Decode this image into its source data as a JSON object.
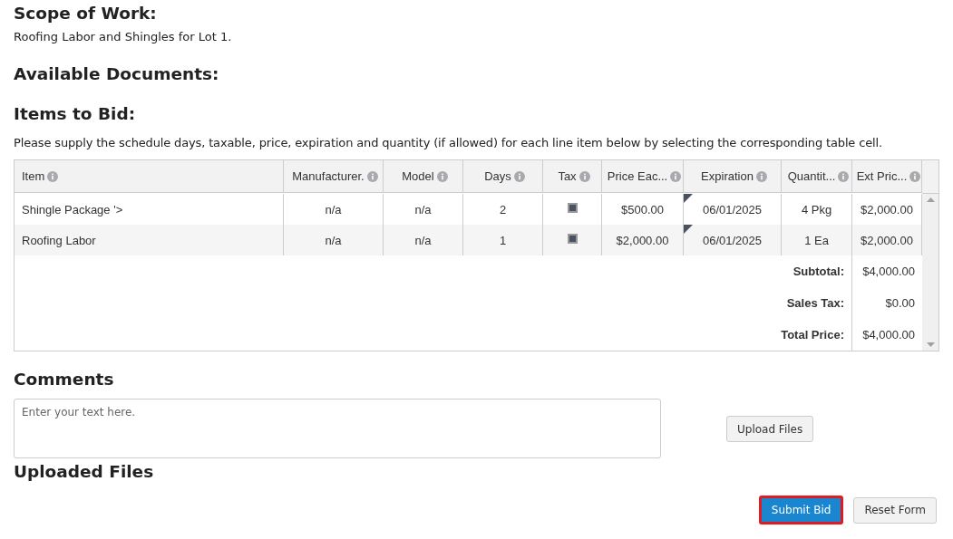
{
  "scope": {
    "heading": "Scope of Work:",
    "text": "Roofing Labor and Shingles for Lot 1."
  },
  "documents": {
    "heading": "Available Documents:"
  },
  "items": {
    "heading": "Items to Bid:",
    "instructions": "Please supply the schedule days, taxable, price, expiration and quantity (if allowed) for each line item below by selecting the corresponding table cell.",
    "columns": [
      {
        "label": "Item"
      },
      {
        "label": "Manufacturer."
      },
      {
        "label": "Model"
      },
      {
        "label": "Days"
      },
      {
        "label": "Tax"
      },
      {
        "label": "Price Eac..."
      },
      {
        "label": "Expiration"
      },
      {
        "label": "Quantit..."
      },
      {
        "label": "Ext Pric..."
      }
    ],
    "rows": [
      {
        "item": "Shingle Package '>",
        "manufacturer": "n/a",
        "model": "n/a",
        "days": "2",
        "tax_checked": true,
        "price": "$500.00",
        "expiration": "06/01/2025",
        "quantity": "4 Pkg",
        "ext_price": "$2,000.00"
      },
      {
        "item": "Roofing Labor",
        "manufacturer": "n/a",
        "model": "n/a",
        "days": "1",
        "tax_checked": true,
        "price": "$2,000.00",
        "expiration": "06/01/2025",
        "quantity": "1 Ea",
        "ext_price": "$2,000.00"
      }
    ],
    "totals": [
      {
        "label": "Subtotal:",
        "value": "$4,000.00"
      },
      {
        "label": "Sales Tax:",
        "value": "$0.00"
      },
      {
        "label": "Total Price:",
        "value": "$4,000.00"
      }
    ]
  },
  "comments": {
    "heading": "Comments",
    "placeholder": "Enter your text here.",
    "upload_button": "Upload Files"
  },
  "uploaded": {
    "heading": "Uploaded Files"
  },
  "buttons": [
    {
      "label": "Submit Bid",
      "kind": "primary"
    },
    {
      "label": "Reset Form",
      "kind": "default"
    }
  ]
}
